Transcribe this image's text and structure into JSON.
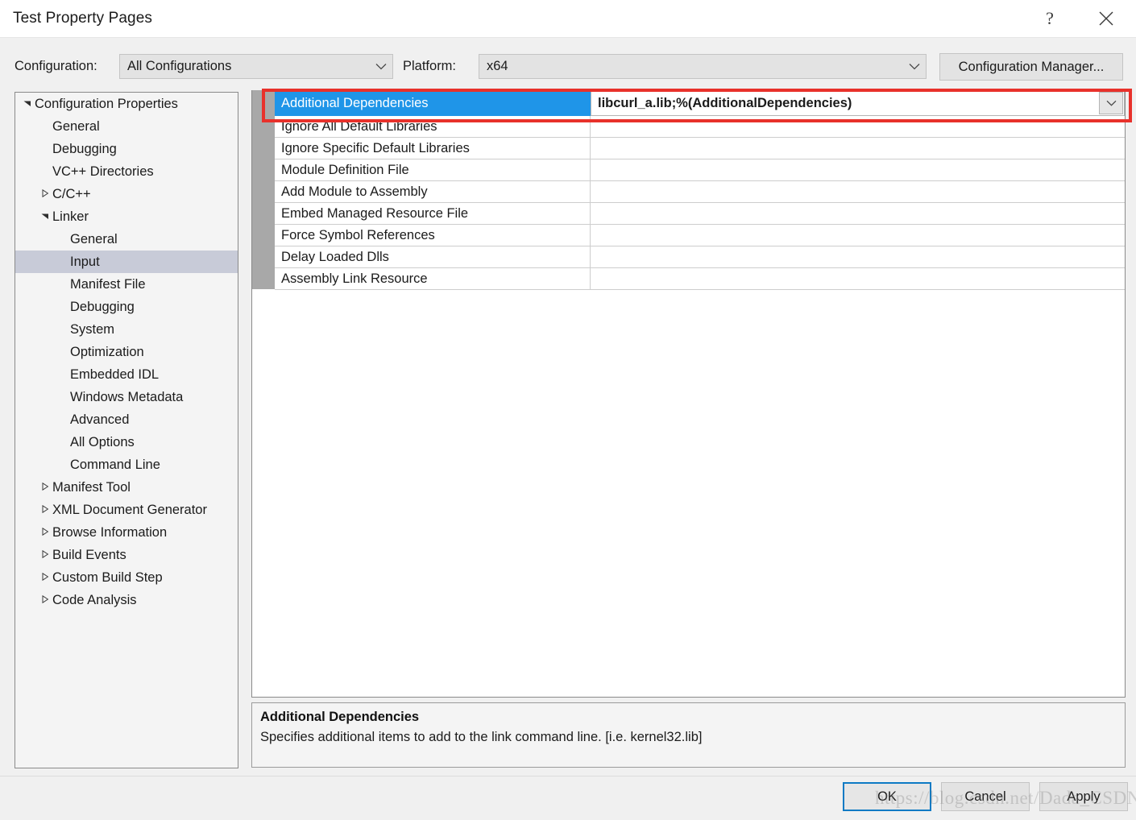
{
  "window": {
    "title": "Test Property Pages",
    "help_icon": "question-mark-icon",
    "close_icon": "close-icon"
  },
  "header": {
    "configuration_label": "Configuration:",
    "configuration_value": "All Configurations",
    "platform_label": "Platform:",
    "platform_value": "x64",
    "configuration_manager_label": "Configuration Manager..."
  },
  "tree": {
    "items": [
      {
        "label": "Configuration Properties",
        "indent": 0,
        "twisty": "expanded",
        "selected": false
      },
      {
        "label": "General",
        "indent": 1,
        "twisty": "none",
        "selected": false
      },
      {
        "label": "Debugging",
        "indent": 1,
        "twisty": "none",
        "selected": false
      },
      {
        "label": "VC++ Directories",
        "indent": 1,
        "twisty": "none",
        "selected": false
      },
      {
        "label": "C/C++",
        "indent": 1,
        "twisty": "collapsed",
        "selected": false
      },
      {
        "label": "Linker",
        "indent": 1,
        "twisty": "expanded",
        "selected": false
      },
      {
        "label": "General",
        "indent": 2,
        "twisty": "none",
        "selected": false
      },
      {
        "label": "Input",
        "indent": 2,
        "twisty": "none",
        "selected": true
      },
      {
        "label": "Manifest File",
        "indent": 2,
        "twisty": "none",
        "selected": false
      },
      {
        "label": "Debugging",
        "indent": 2,
        "twisty": "none",
        "selected": false
      },
      {
        "label": "System",
        "indent": 2,
        "twisty": "none",
        "selected": false
      },
      {
        "label": "Optimization",
        "indent": 2,
        "twisty": "none",
        "selected": false
      },
      {
        "label": "Embedded IDL",
        "indent": 2,
        "twisty": "none",
        "selected": false
      },
      {
        "label": "Windows Metadata",
        "indent": 2,
        "twisty": "none",
        "selected": false
      },
      {
        "label": "Advanced",
        "indent": 2,
        "twisty": "none",
        "selected": false
      },
      {
        "label": "All Options",
        "indent": 2,
        "twisty": "none",
        "selected": false
      },
      {
        "label": "Command Line",
        "indent": 2,
        "twisty": "none",
        "selected": false
      },
      {
        "label": "Manifest Tool",
        "indent": 1,
        "twisty": "collapsed",
        "selected": false
      },
      {
        "label": "XML Document Generator",
        "indent": 1,
        "twisty": "collapsed",
        "selected": false
      },
      {
        "label": "Browse Information",
        "indent": 1,
        "twisty": "collapsed",
        "selected": false
      },
      {
        "label": "Build Events",
        "indent": 1,
        "twisty": "collapsed",
        "selected": false
      },
      {
        "label": "Custom Build Step",
        "indent": 1,
        "twisty": "collapsed",
        "selected": false
      },
      {
        "label": "Code Analysis",
        "indent": 1,
        "twisty": "collapsed",
        "selected": false
      }
    ]
  },
  "grid": {
    "rows": [
      {
        "name": "Additional Dependencies",
        "value": "libcurl_a.lib;%(AdditionalDependencies)",
        "selected": true
      },
      {
        "name": "Ignore All Default Libraries",
        "value": "",
        "selected": false
      },
      {
        "name": "Ignore Specific Default Libraries",
        "value": "",
        "selected": false
      },
      {
        "name": "Module Definition File",
        "value": "",
        "selected": false
      },
      {
        "name": "Add Module to Assembly",
        "value": "",
        "selected": false
      },
      {
        "name": "Embed Managed Resource File",
        "value": "",
        "selected": false
      },
      {
        "name": "Force Symbol References",
        "value": "",
        "selected": false
      },
      {
        "name": "Delay Loaded Dlls",
        "value": "",
        "selected": false
      },
      {
        "name": "Assembly Link Resource",
        "value": "",
        "selected": false
      }
    ]
  },
  "description": {
    "title": "Additional Dependencies",
    "text": "Specifies additional items to add to the link command line. [i.e. kernel32.lib]"
  },
  "footer": {
    "ok_label": "OK",
    "cancel_label": "Cancel",
    "apply_label": "Apply"
  },
  "watermark": {
    "text": "https://blog.csdn.net/Dada_CSDN"
  },
  "colors": {
    "selection_blue": "#1f95e8",
    "tree_selection": "#c8cbd8",
    "annotation_red": "#e8312b",
    "ok_focus_border": "#0d7ac4",
    "dialog_background": "#f0f0f0"
  }
}
